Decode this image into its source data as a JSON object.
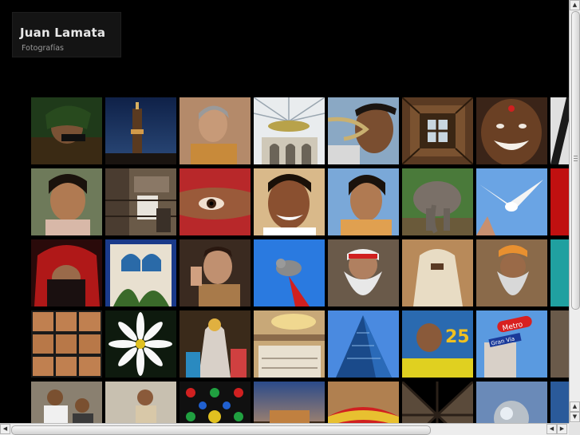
{
  "header": {
    "name": "Juan Lamata",
    "subtitle": "Fotografías"
  },
  "gallery": {
    "photos": [
      {
        "subject": "man-in-turban"
      },
      {
        "subject": "minaret-night"
      },
      {
        "subject": "old-man-profile"
      },
      {
        "subject": "mosque-interior"
      },
      {
        "subject": "snake-charmer"
      },
      {
        "subject": "ornate-ceiling"
      },
      {
        "subject": "smiling-man-bindi"
      },
      {
        "subject": "partial-photo"
      },
      {
        "subject": "girl-portrait"
      },
      {
        "subject": "balconies-laundry"
      },
      {
        "subject": "veiled-eye"
      },
      {
        "subject": "smiling-boy"
      },
      {
        "subject": "young-woman-sky"
      },
      {
        "subject": "elephant"
      },
      {
        "subject": "seagull-flight"
      },
      {
        "subject": "partial-photo"
      },
      {
        "subject": "red-headscarf-woman"
      },
      {
        "subject": "moorish-window-plants"
      },
      {
        "subject": "man-drinking"
      },
      {
        "subject": "pigeon-on-post"
      },
      {
        "subject": "bearded-sadhu"
      },
      {
        "subject": "veiled-woman"
      },
      {
        "subject": "old-sadhu-orange-turban"
      },
      {
        "subject": "partial-photo"
      },
      {
        "subject": "cycling-sequence"
      },
      {
        "subject": "white-flower"
      },
      {
        "subject": "religious-statue"
      },
      {
        "subject": "restaurant-interior"
      },
      {
        "subject": "glass-skyscraper"
      },
      {
        "subject": "movie-poster-25"
      },
      {
        "subject": "metro-gran-via-sign"
      },
      {
        "subject": "partial-photo"
      },
      {
        "subject": "men-with-camera"
      },
      {
        "subject": "man-with-car"
      },
      {
        "subject": "stained-glass"
      },
      {
        "subject": "evening-building"
      },
      {
        "subject": "turban-closeup"
      },
      {
        "subject": "geometric-lattice"
      },
      {
        "subject": "metal-sphere"
      },
      {
        "subject": "partial-photo"
      }
    ],
    "poster_text": "25",
    "sign_text_1": "Metro",
    "sign_text_2": "Gran Via"
  },
  "colors": {
    "background": "#000000",
    "logo_bg": "#141414",
    "logo_text": "#e8e8e8",
    "logo_sub": "#9a9a9a"
  },
  "scrollbars": {
    "up_icon": "▲",
    "down_icon": "▼",
    "left_icon": "◀",
    "right_icon": "▶"
  }
}
